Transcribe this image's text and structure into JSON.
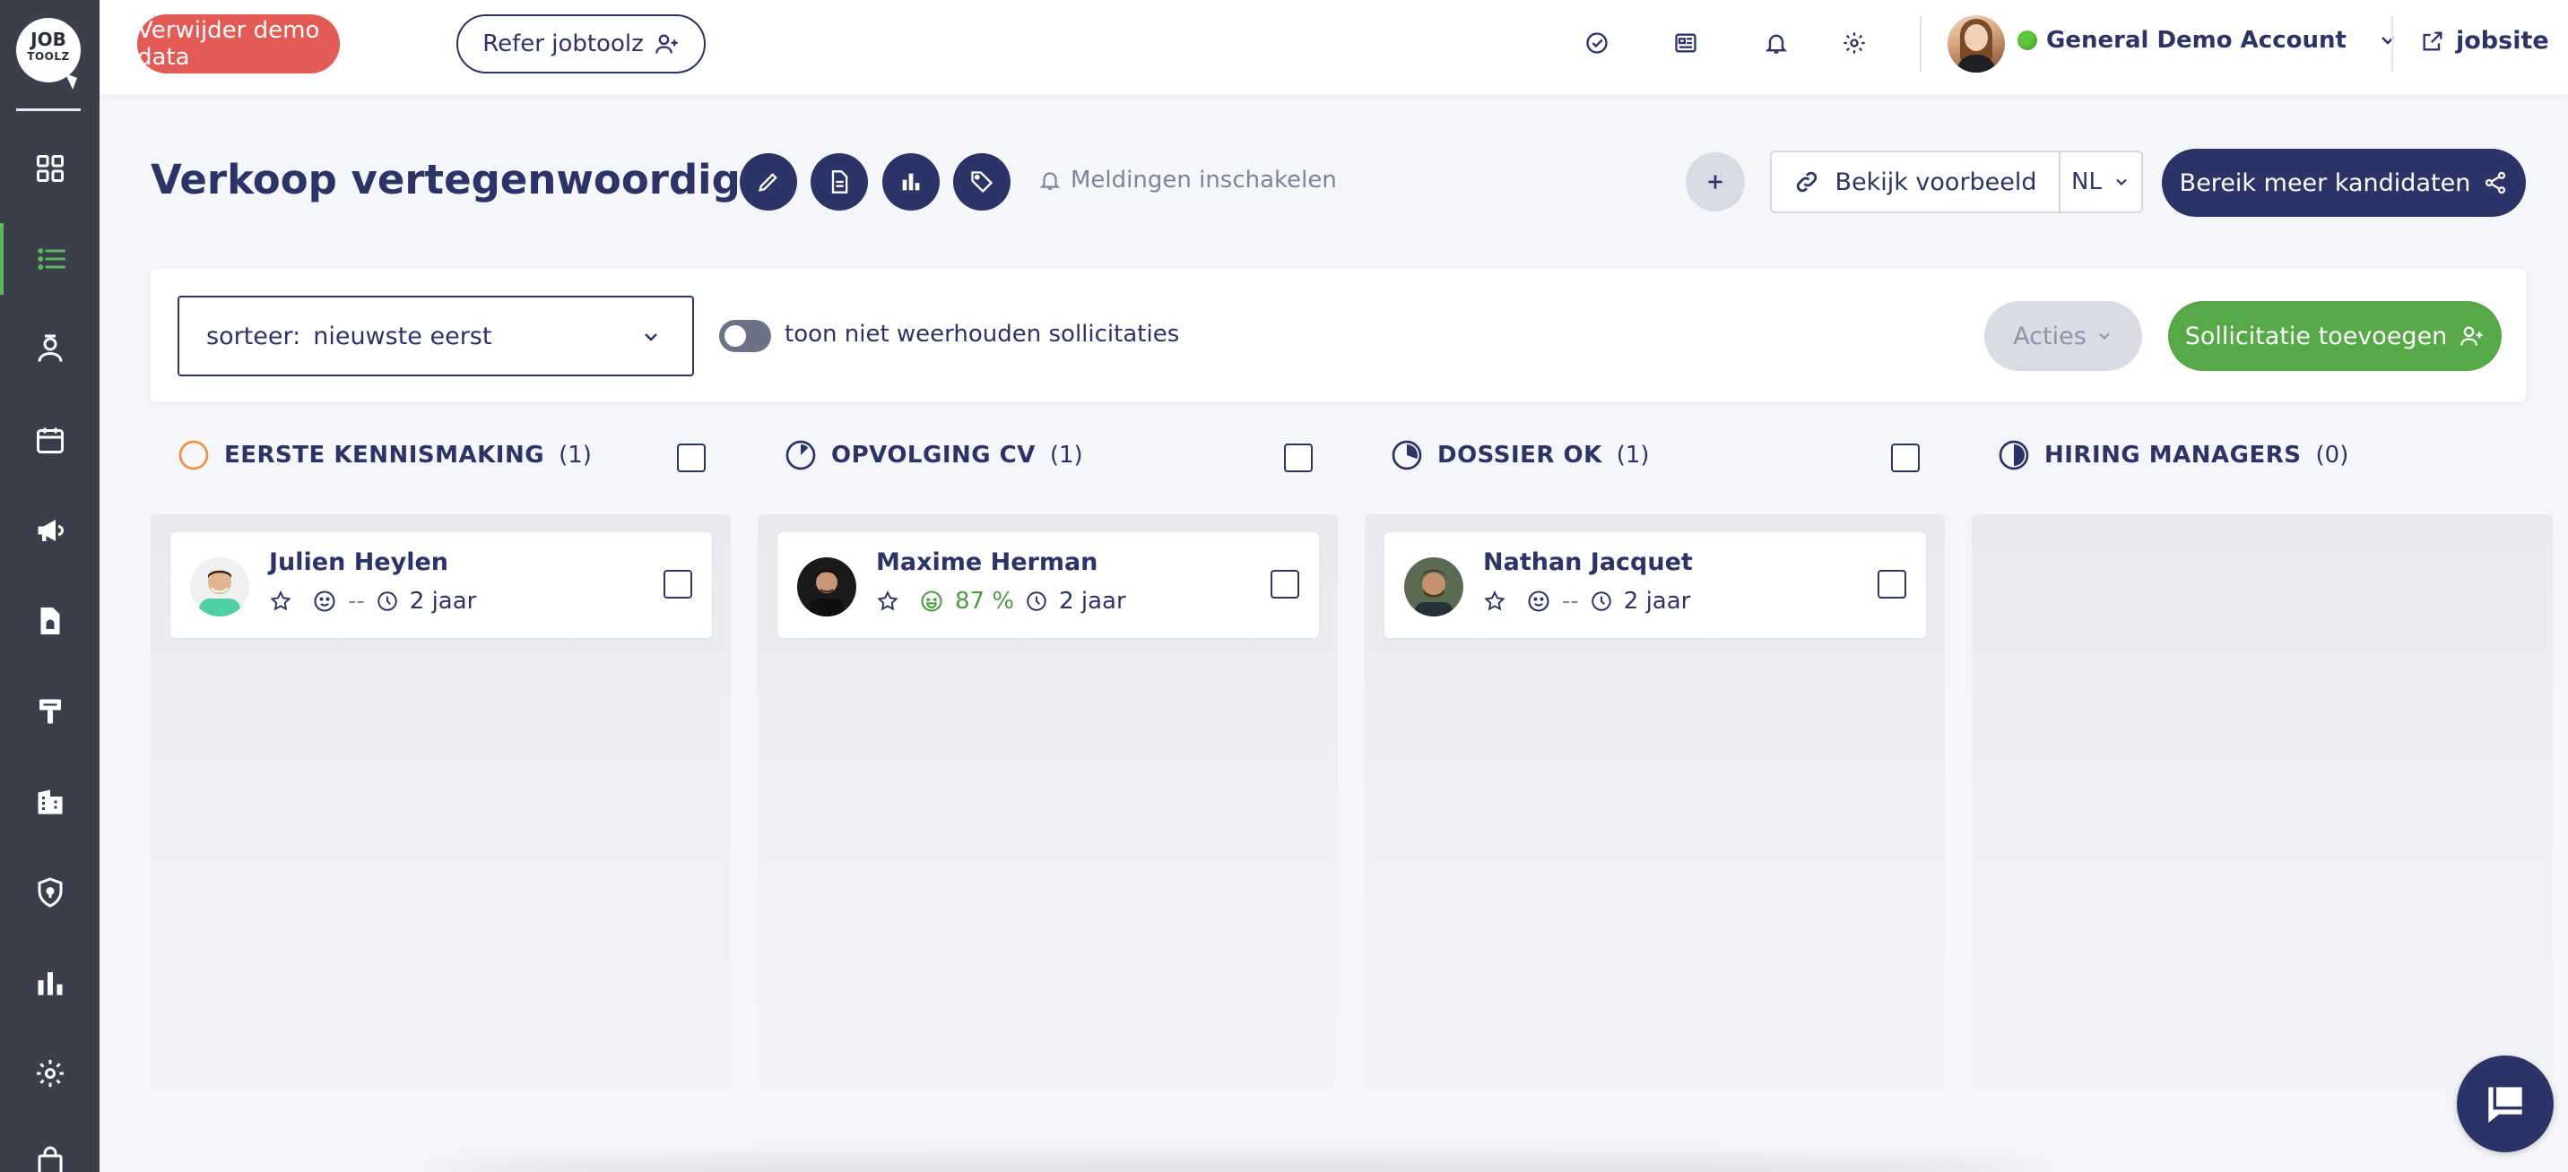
{
  "sidebar": {
    "logo_line1": "JOB",
    "logo_line2": "TOOLZ",
    "items": [
      {
        "name": "dashboard",
        "icon": "grid-icon"
      },
      {
        "name": "vacatures",
        "icon": "list-icon",
        "active": true
      },
      {
        "name": "kandidaten",
        "icon": "person-icon"
      },
      {
        "name": "agenda",
        "icon": "calendar-icon"
      },
      {
        "name": "campagnes",
        "icon": "megaphone-icon"
      },
      {
        "name": "documenten",
        "icon": "file-icon"
      },
      {
        "name": "branding",
        "icon": "paint-roller-icon"
      },
      {
        "name": "bedrijven",
        "icon": "building-icon"
      },
      {
        "name": "beveiliging",
        "icon": "shield-icon"
      },
      {
        "name": "statistieken",
        "icon": "bar-chart-icon"
      },
      {
        "name": "instellingen",
        "icon": "gear-icon"
      },
      {
        "name": "shop",
        "icon": "bag-icon"
      }
    ]
  },
  "topbar": {
    "delete_demo_label": "Verwijder demo data",
    "refer_label": "Refer jobtoolz",
    "account_name": "General Demo Account",
    "jobsite_label": "jobsite"
  },
  "header": {
    "title": "Verkoop vertegenwoordiger",
    "notifications_label": "Meldingen inschakelen",
    "preview_label": "Bekijk voorbeeld",
    "language": "NL",
    "reach_label": "Bereik meer kandidaten"
  },
  "filters": {
    "sort_prefix": "sorteer:",
    "sort_value": "nieuwste eerst",
    "toggle_label": "toon niet weerhouden sollicitaties",
    "toggle_on": false,
    "actions_label": "Acties",
    "add_label": "Sollicitatie toevoegen"
  },
  "columns": [
    {
      "title": "EERSTE KENNISMAKING",
      "count": "(1)",
      "status_icon": "empty-circle-icon",
      "cards": [
        {
          "name": "Julien Heylen",
          "score": "--",
          "age": "2 jaar",
          "score_good": false
        }
      ]
    },
    {
      "title": "OPVOLGING CV",
      "count": "(1)",
      "status_icon": "quarter-pie-icon",
      "cards": [
        {
          "name": "Maxime Herman",
          "score": "87 %",
          "age": "2 jaar",
          "score_good": true
        }
      ]
    },
    {
      "title": "DOSSIER OK",
      "count": "(1)",
      "status_icon": "three-quarter-pie-icon",
      "cards": [
        {
          "name": "Nathan Jacquet",
          "score": "--",
          "age": "2 jaar",
          "score_good": false
        }
      ]
    },
    {
      "title": "HIRING MANAGERS",
      "count": "(0)",
      "status_icon": "half-pie-icon",
      "cards": []
    }
  ],
  "colors": {
    "navy": "#2c3467",
    "red": "#e45a54",
    "green": "#57a846",
    "sidebar": "#3a3f4b",
    "active_indicator": "#5cb85c"
  }
}
